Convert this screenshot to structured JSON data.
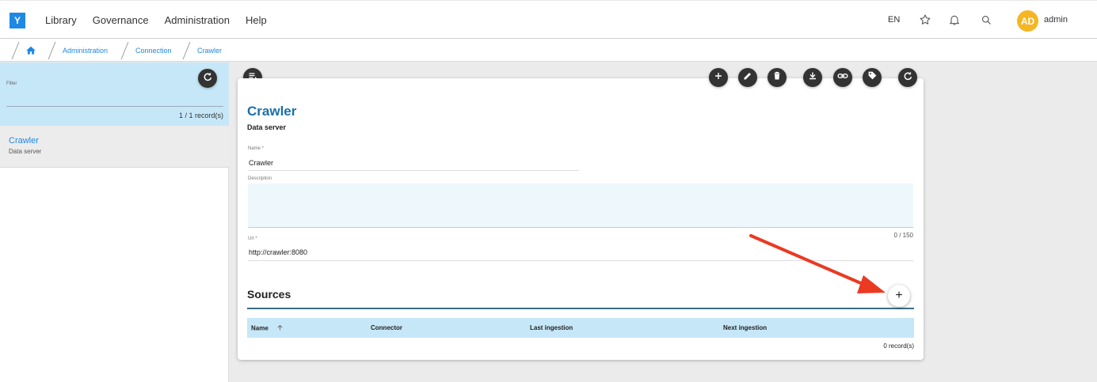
{
  "app": {
    "logo": "Y",
    "nav": [
      "Library",
      "Governance",
      "Administration",
      "Help"
    ],
    "language": "EN",
    "avatar_initials": "AD",
    "username": "admin",
    "accent_color": "#1e88e5"
  },
  "breadcrumb": {
    "items": [
      "Administration",
      "Connection",
      "Crawler"
    ]
  },
  "leftpanel": {
    "filter_label": "Filter",
    "records": "1 / 1 record(s)",
    "items": [
      {
        "title": "Crawler",
        "subtitle": "Data server"
      }
    ]
  },
  "detail": {
    "title": "Crawler",
    "subtitle": "Data server",
    "name_label": "Name *",
    "name_value": "Crawler",
    "description_label": "Description",
    "description_counter": "0 / 150",
    "url_label": "Url *",
    "url_value": "http://crawler:8080",
    "sources_title": "Sources",
    "sources_add": "+",
    "table_headers": [
      "Name",
      "Connector",
      "Last ingestion",
      "Next ingestion"
    ],
    "records": "0 record(s)"
  },
  "icons": [
    "home-icon",
    "star-icon",
    "bell-icon",
    "search-icon",
    "refresh-icon",
    "list-icon",
    "add-icon",
    "edit-icon",
    "delete-icon",
    "download-icon",
    "link-icon",
    "tag-icon",
    "sort-up-icon"
  ]
}
